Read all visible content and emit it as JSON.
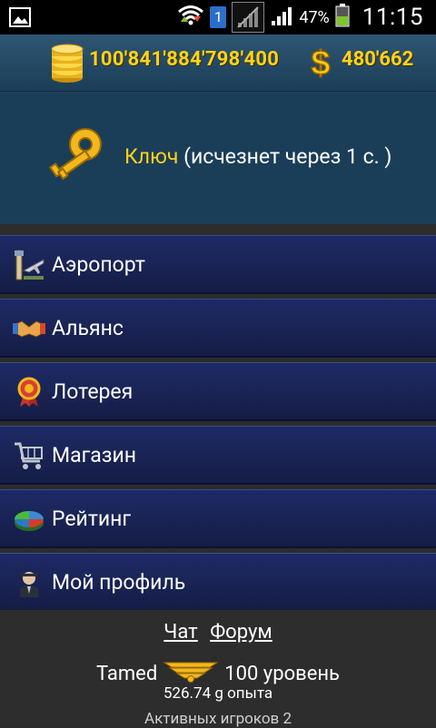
{
  "status_bar": {
    "notification_icon": "image-icon",
    "sim_label": "1",
    "battery_percent": "47%",
    "time": "11:15"
  },
  "currency": {
    "coins": "100'841'884'798'400",
    "dollars": "480'662"
  },
  "key_panel": {
    "item_name": "Ключ",
    "item_note": " (исчезнет через 1 с. )"
  },
  "menu": [
    {
      "label": "Аэропорт",
      "icon": "airport-icon"
    },
    {
      "label": "Альянс",
      "icon": "handshake-icon"
    },
    {
      "label": "Лотерея",
      "icon": "badge-icon"
    },
    {
      "label": "Магазин",
      "icon": "shopping-cart-icon"
    },
    {
      "label": "Рейтинг",
      "icon": "pie-chart-icon"
    },
    {
      "label": "Мой профиль",
      "icon": "pilot-icon"
    }
  ],
  "footer": {
    "chat_link": "Чат",
    "forum_link": "Форум",
    "username": "Tamed",
    "level": "100 уровень",
    "experience": "526.74 g опыта",
    "active_players": "Активных игроков 2"
  },
  "colors": {
    "accent_gold": "#ffd21a",
    "panel_blue": "#1b3e58",
    "menu_blue": "#1a2456",
    "footer_gray": "#2d2d2d"
  }
}
